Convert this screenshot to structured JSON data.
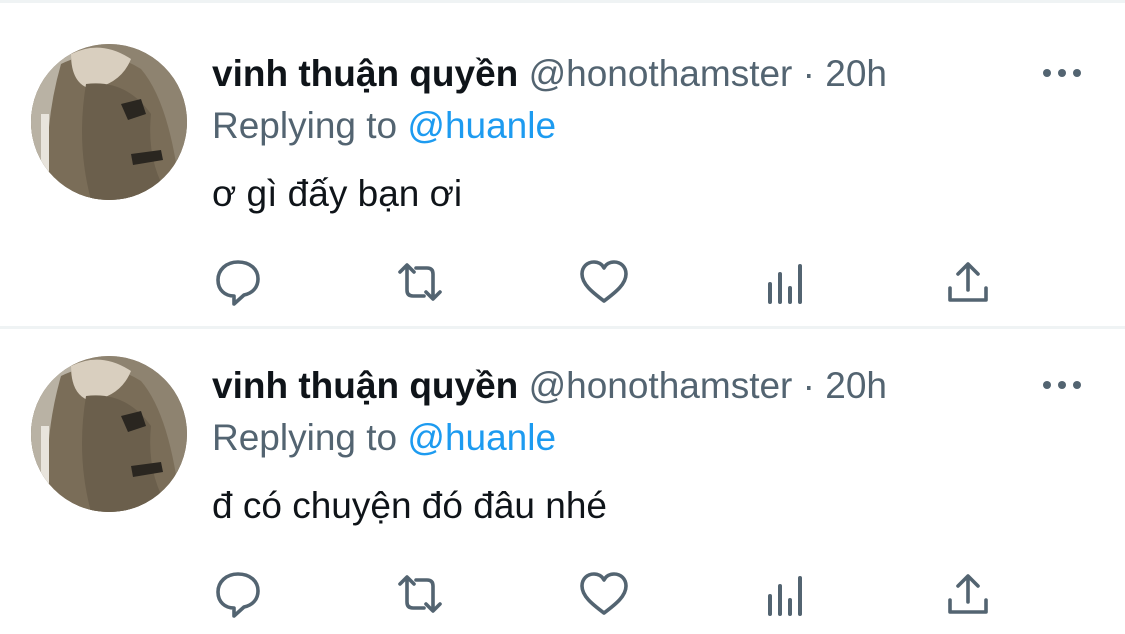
{
  "tweets": [
    {
      "display_name": "vinh thuận quyền",
      "handle": "@honothamster",
      "separator": "·",
      "time": "20h",
      "replying_prefix": "Replying to",
      "reply_to": "@huanle",
      "text": "ơ gì đấy bạn ơi"
    },
    {
      "display_name": "vinh thuận quyền",
      "handle": "@honothamster",
      "separator": "·",
      "time": "20h",
      "replying_prefix": "Replying to",
      "reply_to": "@huanle",
      "text": "đ có chuyện đó đâu nhé"
    }
  ],
  "icons": {
    "reply": "reply-icon",
    "retweet": "retweet-icon",
    "like": "like-icon",
    "views": "views-icon",
    "share": "share-icon",
    "more": "more-icon"
  },
  "colors": {
    "text_primary": "#0f1419",
    "text_secondary": "#536471",
    "link": "#1d9bf0",
    "divider": "#eff3f4"
  }
}
